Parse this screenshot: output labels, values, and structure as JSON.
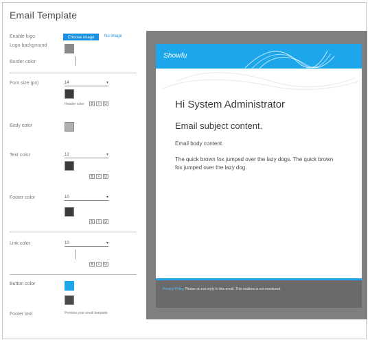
{
  "page": {
    "title": "Email Template"
  },
  "panel": {
    "rows": [
      {
        "label": "Enable logo",
        "button": "Choose image",
        "link": "No image"
      },
      {
        "label": "Logo background",
        "swatch": "#8a8a8a"
      },
      {
        "label": "Border color"
      },
      {
        "label": "Font size (px)"
      },
      {
        "label": "Header color",
        "swatch": "#3b3b3b"
      },
      {
        "label": "Body color",
        "swatch": "#b0b0b0"
      },
      {
        "label": "Text color",
        "swatch": "#3b3b3b"
      },
      {
        "label": "Footer color",
        "swatch": "#3b3b3b"
      },
      {
        "label": "Link color",
        "swatch": "#1ea6ea"
      },
      {
        "label": "Button color",
        "swatch": "#4a4a4a"
      },
      {
        "label": "Footer text"
      }
    ],
    "preview_hint": "Preview your email template"
  },
  "email": {
    "brand": "Showfu",
    "greeting": "Hi System Administrator",
    "subject": "Email subject content.",
    "body_line": "Email body content.",
    "paragraph": "The quick brown fox jumped over the lazy dogs. The quick brown fox jumped over the lazy dog.",
    "footer": {
      "link_text": "Privacy Policy",
      "text": "Please do not reply to this email. This mailbox is not monitored."
    }
  },
  "colors": {
    "primary": "#1ea6ea",
    "preview_bg": "#7f7f7f",
    "footer_bg": "#6a6a6a"
  }
}
